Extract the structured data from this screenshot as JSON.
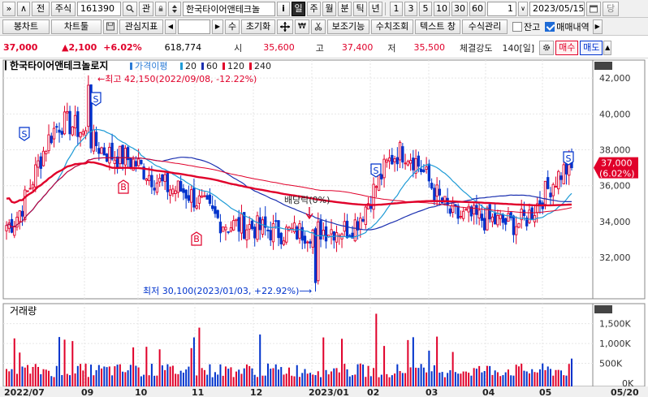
{
  "toolbar1": {
    "nav_prev": "»",
    "nav_up": "∧",
    "nav_all": "전",
    "market": "주식",
    "code": "161390",
    "search_icon": "magnifier-icon",
    "watch": "관",
    "lock_icon": "lock-icon",
    "spin_icon": "stepper-icon",
    "stock_name": "한국타이어앤테크놀",
    "info_btn": "i",
    "periods": [
      "일",
      "주",
      "월",
      "분",
      "틱",
      "년"
    ],
    "selected_period": "일",
    "minutes": [
      "1",
      "3",
      "5",
      "10",
      "30",
      "60"
    ],
    "count": "1",
    "date": "2023/05/15",
    "date_icon": "calendar-icon",
    "extra": "당"
  },
  "toolbar2": {
    "chart_type": "봉차트",
    "chart_tools": "차트툴",
    "save_icon": "save-icon",
    "indicators": "관심지표",
    "play_prev": "◀",
    "play_next": "▶",
    "modify": "수",
    "reset": "초기화",
    "crosshair_icon": "crosshair-icon",
    "cut_icon": "scissors-icon",
    "assist": "보조기능",
    "query": "수치조회",
    "text_window": "텍스트 창",
    "formula": "수식관리",
    "balance_label": "잔고",
    "trades_label": "매매내역",
    "balance_checked": false,
    "trades_checked": true
  },
  "infobar": {
    "price": "37,000",
    "change": "▲2,100",
    "change_pct": "+6.02%",
    "volume": "618,774",
    "open_label": "시",
    "open": "35,600",
    "high_label": "고",
    "high": "37,400",
    "low_label": "저",
    "low": "35,500",
    "strength_label": "체결강도",
    "strength": "140[일]",
    "settings_icon": "gear-icon",
    "buy": "매수",
    "sell": "매도"
  },
  "chart_data": {
    "type": "candlestick",
    "title": "한국타이어앤테크놀로지",
    "legend": [
      {
        "label": "가격이평",
        "color": "#2b7bd6"
      },
      {
        "label": "20",
        "color": "#1e9bd6"
      },
      {
        "label": "60",
        "color": "#1a2fb0"
      },
      {
        "label": "120",
        "color": "#e0002a"
      },
      {
        "label": "240",
        "color": "#e0002a"
      }
    ],
    "y_ticks": [
      "42,000",
      "40,000",
      "38,000",
      "36,000",
      "34,000",
      "32,000"
    ],
    "y_values": [
      42000,
      40000,
      38000,
      36000,
      34000,
      32000
    ],
    "ylim": [
      29700,
      43000
    ],
    "x_ticks": [
      "2022/07",
      "09",
      "10",
      "11",
      "12",
      "2023/01",
      "02",
      "03",
      "04",
      "05",
      "05/20"
    ],
    "current_price_label": "37,000",
    "current_pct_label": "(6.02%)",
    "high_annotation": "←최고 42,150(2022/09/08, -12.22%)",
    "low_annotation": "최저 30,100(2023/01/03, +22.92%)⟶",
    "dividend_annotation": "배당락(0%)",
    "high_value": 42150,
    "low_value": 30100,
    "markers": [
      {
        "label": "S"
      },
      {
        "label": "S"
      },
      {
        "label": "B"
      },
      {
        "label": "B"
      },
      {
        "label": "S"
      },
      {
        "label": "S"
      }
    ],
    "monthly_close": [
      {
        "month": "2022/07",
        "close": 33800
      },
      {
        "month": "08",
        "close": 39500
      },
      {
        "month": "09",
        "close": 37600
      },
      {
        "month": "10",
        "close": 35800
      },
      {
        "month": "11",
        "close": 33800
      },
      {
        "month": "12",
        "close": 33400
      },
      {
        "month": "2023/01",
        "close": 33600
      },
      {
        "month": "02",
        "close": 37900
      },
      {
        "month": "03",
        "close": 34300
      },
      {
        "month": "04",
        "close": 33900
      },
      {
        "month": "05",
        "close": 37000
      }
    ],
    "volume_panel_title": "거래량",
    "volume_ticks": [
      "1,500K",
      "1,000K",
      "500K",
      "0K"
    ],
    "volume_values": [
      1500,
      1000,
      500,
      0
    ],
    "volume_unit": "K"
  }
}
